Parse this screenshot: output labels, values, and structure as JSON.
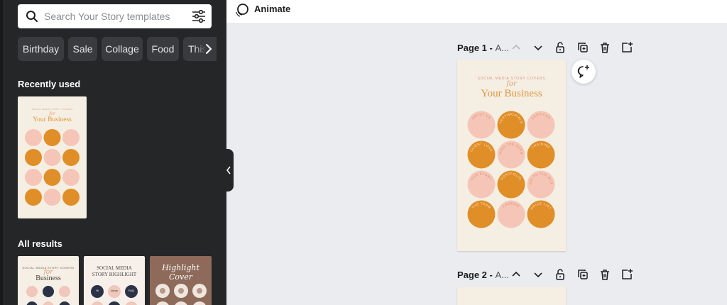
{
  "search": {
    "placeholder": "Search Your Story templates",
    "value": ""
  },
  "chips": [
    "Birthday",
    "Sale",
    "Collage",
    "Food",
    "This"
  ],
  "sections": {
    "recent": "Recently used",
    "all": "All results"
  },
  "top_bar": {
    "animate_label": "Animate"
  },
  "pages": [
    {
      "label": "Page 1 -",
      "name": "A..."
    },
    {
      "label": "Page 2 -",
      "name": "A..."
    }
  ],
  "design": {
    "subtitle": "SOCIAL MEDIA STORY COVERS",
    "script_word": "for",
    "title": "Your Business",
    "circle_labels": [
      "ABOUT US",
      "TESTIMONIALS",
      "SERVICES",
      "CLIENT LOVE",
      "BEHIND THE SCENES",
      "TRAINING",
      "OUR STORY",
      "PORTFOLIO",
      "NEW ON THE BLOG",
      "THE TEAM",
      "FREEBIE",
      "PRICE LIST"
    ]
  },
  "result_thumbs": [
    {
      "line1": "SOCIAL MEDIA STORY COVERS",
      "line2": "for",
      "line3": "Business"
    },
    {
      "line1": "SOCIAL MEDIA",
      "line2": "STORY HIGHLIGHT",
      "labels": [
        "Hi",
        "Ideas",
        "FAQ"
      ]
    },
    {
      "title": "Highlight Cover"
    }
  ],
  "colors": {
    "orange": "#e08e27",
    "pink": "#f5c6b8",
    "cream": "#f5eee3",
    "panel": "#252627",
    "canvas_bg": "#ebecf0"
  }
}
